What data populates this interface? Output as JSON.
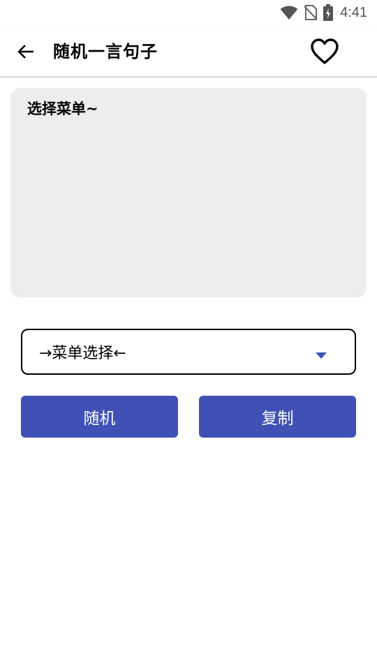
{
  "status_bar": {
    "time": "4:41",
    "icons": [
      "wifi-icon",
      "no-sim-icon",
      "battery-charging-icon"
    ]
  },
  "app_bar": {
    "title": "随机一言句子",
    "back_icon": "arrow-back-icon",
    "favorite_icon": "heart-outline-icon"
  },
  "content": {
    "quote_text": "选择菜单~"
  },
  "menu_select": {
    "selected_value": "→菜单选择←",
    "arrow_color": "#3f51b5"
  },
  "buttons": {
    "random_label": "随机",
    "copy_label": "复制",
    "color": "#3f51b5"
  }
}
